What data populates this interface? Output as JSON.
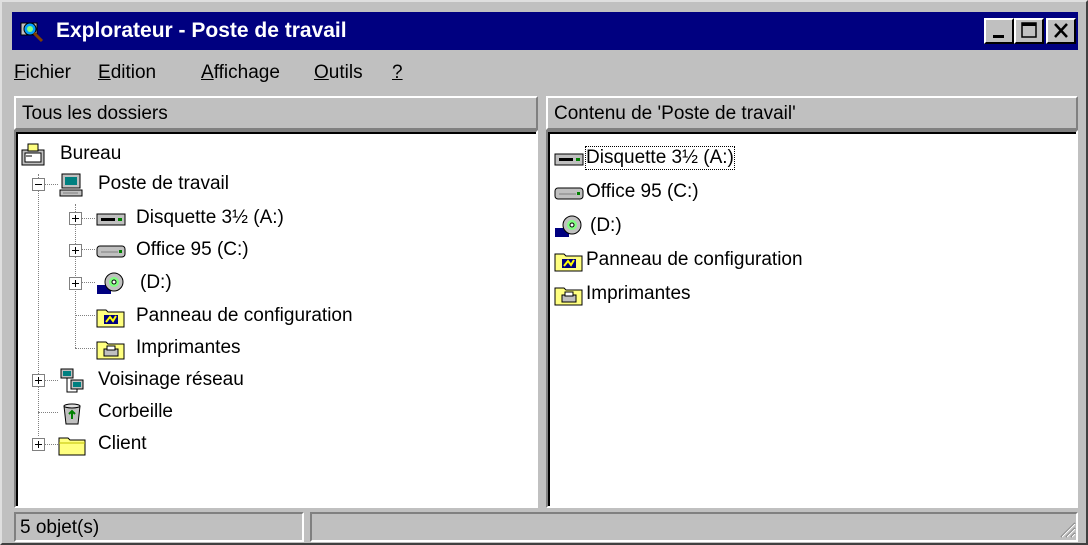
{
  "window": {
    "title": "Explorateur - Poste de travail"
  },
  "menu": [
    {
      "label": "Fichier",
      "accel": "F",
      "rest": "ichier"
    },
    {
      "label": "Edition",
      "accel": "E",
      "rest": "dition"
    },
    {
      "label": "Affichage",
      "accel": "A",
      "rest": "ffichage"
    },
    {
      "label": "Outils",
      "accel": "O",
      "rest": "utils"
    },
    {
      "label": "?",
      "accel": "?",
      "rest": ""
    }
  ],
  "left_pane": {
    "header": "Tous les dossiers",
    "tree": [
      {
        "label": "Bureau",
        "icon": "desktop-icon"
      },
      {
        "label": "Poste de travail",
        "icon": "computer-icon"
      },
      {
        "label": "Disquette 3½ (A:)",
        "icon": "floppy-drive-icon"
      },
      {
        "label": "Office 95 (C:)",
        "icon": "hard-drive-icon"
      },
      {
        "label": "(D:)",
        "icon": "cdrom-drive-icon"
      },
      {
        "label": "Panneau de configuration",
        "icon": "control-panel-icon"
      },
      {
        "label": "Imprimantes",
        "icon": "printers-folder-icon"
      },
      {
        "label": "Voisinage réseau",
        "icon": "network-icon"
      },
      {
        "label": "Corbeille",
        "icon": "recycle-bin-icon"
      },
      {
        "label": "Client",
        "icon": "folder-icon"
      }
    ]
  },
  "right_pane": {
    "header": "Contenu de 'Poste de travail'",
    "items": [
      {
        "label": "Disquette 3½ (A:)",
        "icon": "floppy-drive-icon"
      },
      {
        "label": "Office 95 (C:)",
        "icon": "hard-drive-icon"
      },
      {
        "label": "(D:)",
        "icon": "cdrom-drive-icon"
      },
      {
        "label": "Panneau de configuration",
        "icon": "control-panel-icon"
      },
      {
        "label": "Imprimantes",
        "icon": "printers-folder-icon"
      }
    ]
  },
  "status": {
    "count": "5 objet(s)",
    "detail": ""
  },
  "colors": {
    "title_bar": "#000080",
    "face": "#c0c0c0",
    "window_bg": "#ffffff"
  }
}
